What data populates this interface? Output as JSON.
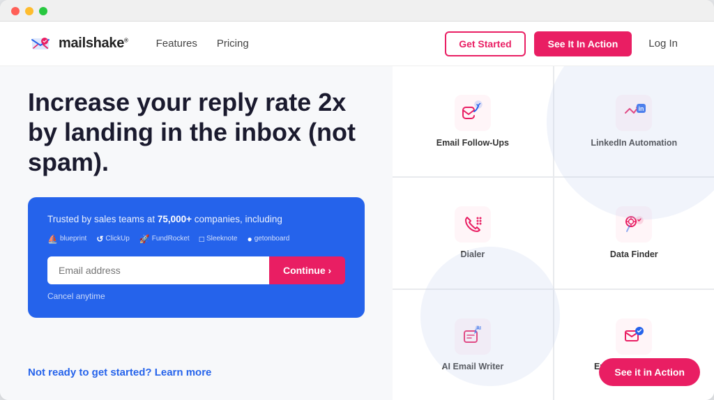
{
  "browser": {
    "dots": [
      "red",
      "yellow",
      "green"
    ]
  },
  "nav": {
    "logo_text": "mailshake",
    "logo_superscript": "®",
    "links": [
      "Features",
      "Pricing"
    ],
    "get_started_label": "Get Started",
    "see_it_label": "See It In Action",
    "login_label": "Log In"
  },
  "hero": {
    "headline": "Increase your reply rate 2x by landing in the inbox (not spam).",
    "cta_card": {
      "trust_text": "Trusted by sales teams at ",
      "trust_highlight": "75,000+",
      "trust_suffix": " companies, including",
      "companies": [
        {
          "symbol": "⛵",
          "name": "blueprint"
        },
        {
          "symbol": "↺",
          "name": "ClickUp"
        },
        {
          "symbol": "🚀",
          "name": "FundRocket"
        },
        {
          "symbol": "□",
          "name": "Sleeknote"
        },
        {
          "symbol": "●",
          "name": "getonboard"
        }
      ],
      "email_placeholder": "Email address",
      "continue_label": "Continue ›",
      "cancel_text": "Cancel anytime"
    },
    "bottom_link_text": "Not ready to get started? Learn more"
  },
  "features": [
    {
      "id": "email-followups",
      "label": "Email Follow-Ups",
      "icon_color": "#e91e63"
    },
    {
      "id": "linkedin-automation",
      "label": "LinkedIn Automation",
      "icon_color": "#e91e63"
    },
    {
      "id": "dialer",
      "label": "Dialer",
      "icon_color": "#e91e63"
    },
    {
      "id": "data-finder",
      "label": "Data Finder",
      "icon_color": "#e91e63"
    },
    {
      "id": "ai-email-writer",
      "label": "AI Email Writer",
      "icon_color": "#e91e63"
    },
    {
      "id": "email-deliverability",
      "label": "Email Deliverability",
      "icon_color": "#e91e63"
    }
  ],
  "bottom_action": {
    "label": "See it in Action"
  }
}
